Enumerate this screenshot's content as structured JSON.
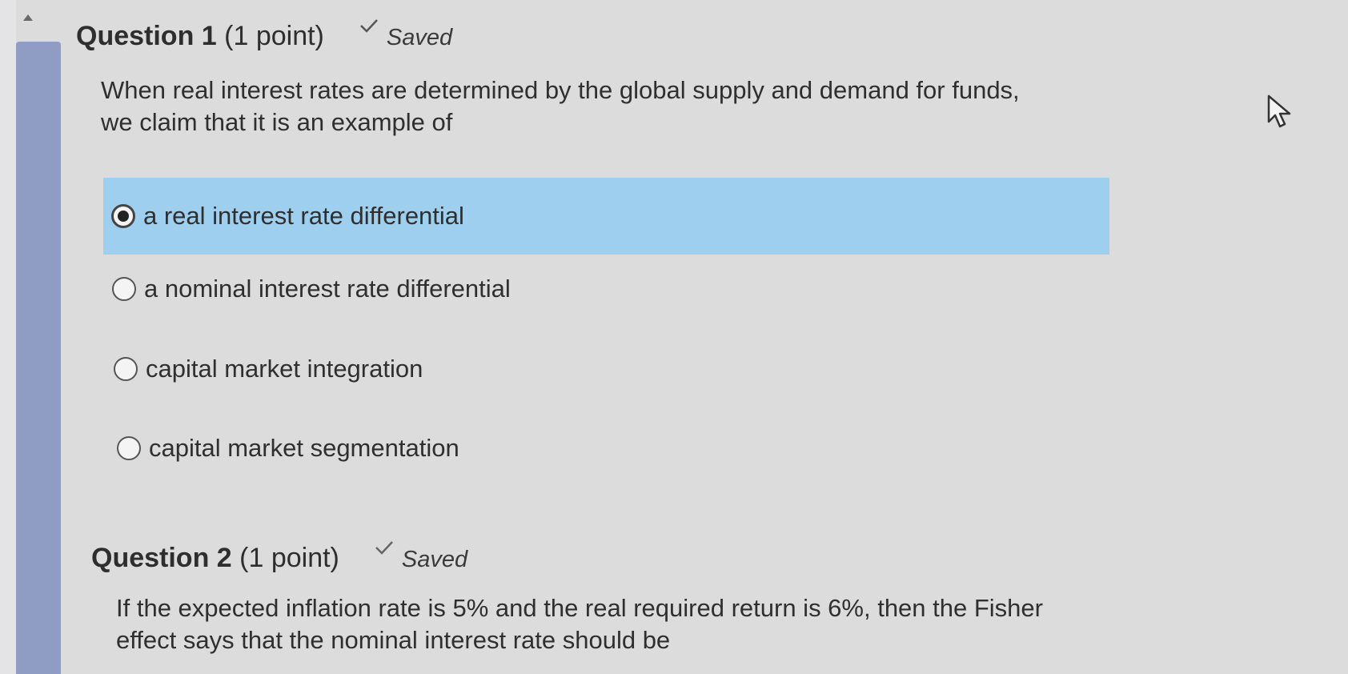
{
  "question1": {
    "title_bold": "Question 1",
    "title_points": "(1 point)",
    "saved_label": "Saved",
    "text_line1": "When real interest rates are determined by the global supply and demand for funds,",
    "text_line2": "we claim that it is an example of",
    "options": [
      {
        "label": "a real interest rate differential",
        "selected": true
      },
      {
        "label": "a nominal interest rate differential",
        "selected": false
      },
      {
        "label": "capital market integration",
        "selected": false
      },
      {
        "label": "capital market segmentation",
        "selected": false
      }
    ]
  },
  "question2": {
    "title_bold": "Question 2",
    "title_points": "(1 point)",
    "saved_label": "Saved",
    "text_line1": "If the expected inflation rate is 5% and the real required return is 6%, then the Fisher",
    "text_line2": "effect says that the nominal interest rate should be"
  },
  "icons": {
    "saved": "check-icon",
    "cursor": "mouse-pointer-icon",
    "scroll": "scroll-up-arrow-icon"
  },
  "colors": {
    "selected_option_bg": "#9fcfee",
    "scroll_thumb": "#8f9cc4"
  }
}
